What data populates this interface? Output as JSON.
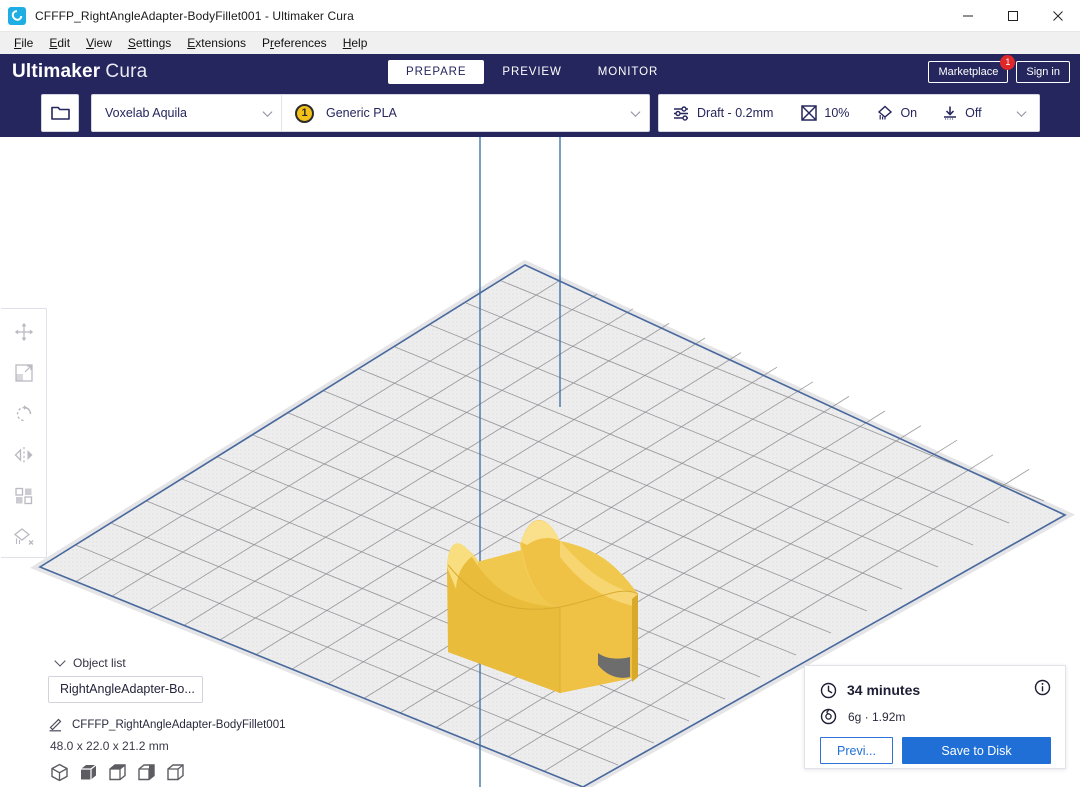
{
  "window": {
    "title": "CFFFP_RightAngleAdapter-BodyFillet001 - Ultimaker Cura",
    "logo_icon": "cura-logo-icon",
    "minimize_icon": "minimize-icon",
    "maximize_icon": "maximize-icon",
    "close_icon": "close-icon"
  },
  "menubar": {
    "items": [
      {
        "label": "File",
        "accel": "F"
      },
      {
        "label": "Edit",
        "accel": "E"
      },
      {
        "label": "View",
        "accel": "V"
      },
      {
        "label": "Settings",
        "accel": "S"
      },
      {
        "label": "Extensions",
        "accel": "E"
      },
      {
        "label": "Preferences",
        "accel": "P"
      },
      {
        "label": "Help",
        "accel": "H"
      }
    ]
  },
  "header": {
    "brand_bold": "Ultimaker",
    "brand_light": "Cura",
    "tabs": [
      {
        "label": "PREPARE",
        "active": true
      },
      {
        "label": "PREVIEW",
        "active": false
      },
      {
        "label": "MONITOR",
        "active": false
      }
    ],
    "marketplace_label": "Marketplace",
    "marketplace_badge": "1",
    "signin_label": "Sign in"
  },
  "configbar": {
    "open_file_icon": "folder-icon",
    "printer": {
      "name": "Voxelab Aquila",
      "chevron_icon": "chevron-down-icon"
    },
    "material": {
      "extruder_number": "1",
      "name": "Generic PLA",
      "chevron_icon": "chevron-down-icon"
    },
    "settings": {
      "profile_icon": "sliders-icon",
      "profile_label": "Draft - 0.2mm",
      "infill_icon": "infill-icon",
      "infill_label": "10%",
      "support_icon": "support-icon",
      "support_label": "On",
      "adhesion_icon": "adhesion-icon",
      "adhesion_label": "Off",
      "chevron_icon": "chevron-down-icon"
    }
  },
  "tools": [
    {
      "name": "move-tool",
      "icon": "move-icon"
    },
    {
      "name": "scale-tool",
      "icon": "scale-icon"
    },
    {
      "name": "rotate-tool",
      "icon": "rotate-icon"
    },
    {
      "name": "mirror-tool",
      "icon": "mirror-icon"
    },
    {
      "name": "per-model-settings-tool",
      "icon": "per-model-settings-icon"
    },
    {
      "name": "support-blocker-tool",
      "icon": "support-blocker-icon"
    }
  ],
  "object_list": {
    "caret_icon": "chevron-down-icon",
    "title": "Object list",
    "selected_object": "RightAngleAdapter-Bo...",
    "edit_icon": "pencil-icon",
    "filename": "CFFFP_RightAngleAdapter-BodyFillet001",
    "dimensions": "48.0 x 22.0 x 21.2 mm",
    "view_icons": [
      "view-3d-icon",
      "view-front-icon",
      "view-top-icon",
      "view-left-icon",
      "view-right-icon"
    ]
  },
  "print_info": {
    "time_icon": "clock-icon",
    "time": "34 minutes",
    "info_icon": "info-icon",
    "material_icon": "spool-icon",
    "material": "6g · 1.92m",
    "preview_label": "Previ...",
    "save_label": "Save to Disk"
  },
  "colors": {
    "header_navy": "#25265e",
    "accent_blue": "#1f6fd6",
    "model_yellow": "#f0c447",
    "badge_red": "#e0272a",
    "extruder_gold": "#f4c01a",
    "plate_grey": "#eceded"
  }
}
